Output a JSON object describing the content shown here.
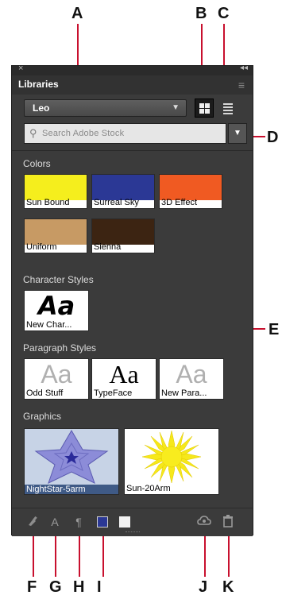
{
  "callouts": [
    "A",
    "B",
    "C",
    "D",
    "E",
    "F",
    "G",
    "H",
    "I",
    "J",
    "K"
  ],
  "panel": {
    "close_glyph": "×",
    "collapse_glyph": "◂◂",
    "tab_label": "Libraries",
    "menu_glyph": "≡",
    "library_dropdown": {
      "value": "Leo",
      "arrow": "▼"
    },
    "search": {
      "placeholder": "Search Adobe Stock",
      "stock_arrow": "▼"
    }
  },
  "sections": {
    "colors": "Colors",
    "character_styles": "Character Styles",
    "paragraph_styles": "Paragraph Styles",
    "graphics": "Graphics"
  },
  "colors": [
    {
      "name": "Sun Bound",
      "hex": "#f5ee1d"
    },
    {
      "name": "Surreal Sky",
      "hex": "#2b3895"
    },
    {
      "name": "3D Effect",
      "hex": "#f05a22"
    },
    {
      "name": "Uniform",
      "hex": "#c79a64"
    },
    {
      "name": "Sienna",
      "hex": "#3c2412"
    }
  ],
  "character_styles": [
    {
      "name": "New Char...",
      "glyph": "Aa"
    }
  ],
  "paragraph_styles": [
    {
      "name": "Odd Stuff",
      "glyph": "Aa"
    },
    {
      "name": "TypeFace",
      "glyph": "Aa"
    },
    {
      "name": "New Para...",
      "glyph": "Aa"
    }
  ],
  "graphics": [
    {
      "name": "NightStar-5arm"
    },
    {
      "name": "Sun-20Arm"
    }
  ],
  "bottom_icons": [
    "brush-icon",
    "text-style-icon",
    "paragraph-icon",
    "fill-color-icon",
    "stroke-color-icon",
    "cloud-sync-icon",
    "trash-icon"
  ],
  "accent": "#c8102e"
}
